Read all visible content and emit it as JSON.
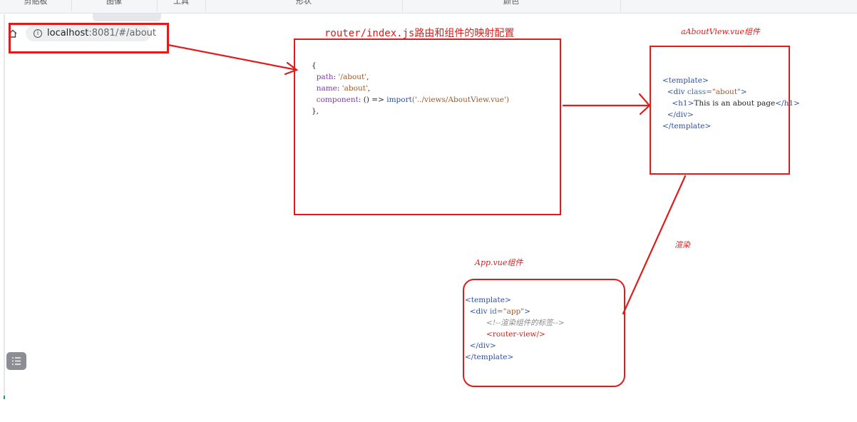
{
  "ribbon": {
    "groups": [
      "剪贴板",
      "图像",
      "工具",
      "形状",
      "颜色"
    ]
  },
  "browser": {
    "url_host": "localhost",
    "url_rest": ":8081/#/about"
  },
  "diagram": {
    "router_caption": "router/index.js路由和组件的映射配置",
    "about_caption": "aAboutView.vue组件",
    "app_caption": "App.vue组件",
    "render_label": "渲染",
    "router_code": {
      "open": "{",
      "path_key": "path",
      "path_val": "'/about'",
      "name_key": "name",
      "name_val": "'about'",
      "component_key": "component",
      "component_arrow": "() =>",
      "component_fn": "import",
      "component_arg": "('../views/AboutView.vue')",
      "close": "},"
    },
    "about_code": {
      "l1": "<template>",
      "l2_tag": "<div",
      "l2_attr": "class=",
      "l2_val": "\"about\"",
      "l2_end": ">",
      "l3_open": "<h1>",
      "l3_text": "This is an about page",
      "l3_close": "</h1>",
      "l4": "</div>",
      "l5": "</template>"
    },
    "app_code": {
      "l1": "<template>",
      "l2_tag": "<div",
      "l2_attr": "id=",
      "l2_val": "\"app\"",
      "l2_end": ">",
      "l3_comment": "<!--渲染组件的标签-->",
      "l4": "<router-view/>",
      "l5": "</div>",
      "l6": "</template>"
    }
  },
  "colors": {
    "annotation_red": "#e01b1b"
  }
}
